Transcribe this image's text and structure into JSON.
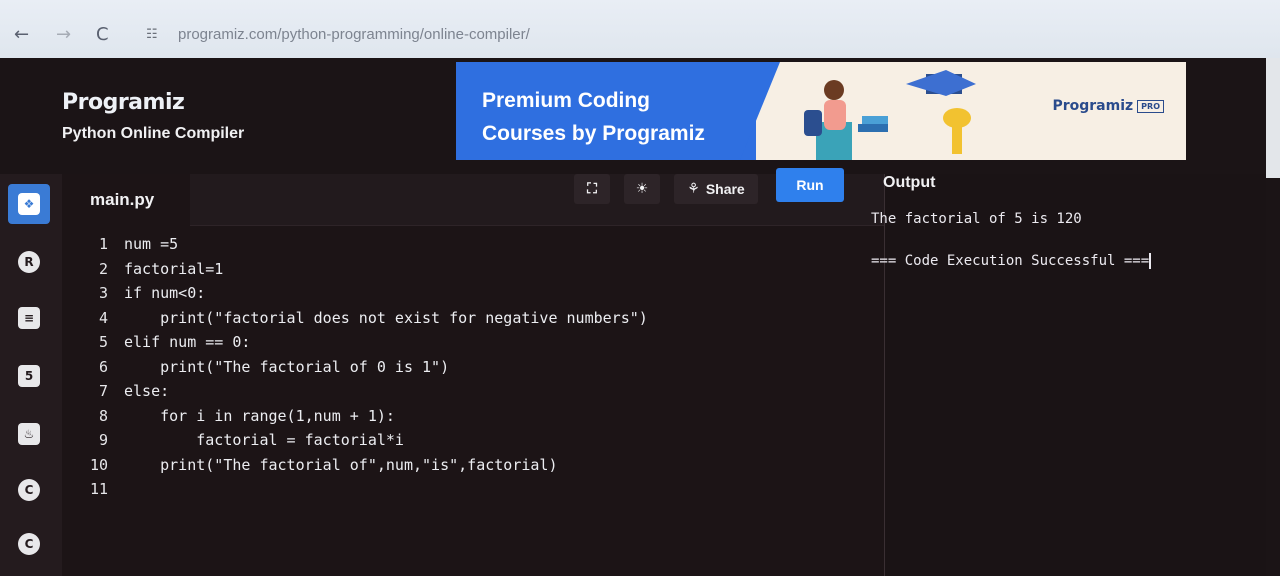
{
  "browser": {
    "back_icon": "←",
    "forward_icon": "→",
    "reload_icon": "C",
    "site_info_icon": "☷",
    "url": "programiz.com/python-programming/online-compiler/"
  },
  "header": {
    "logo": "Programiz",
    "subtitle": "Python Online Compiler"
  },
  "ad": {
    "headline_line1": "Premium Coding",
    "headline_line2": "Courses by Programiz",
    "brand": "Programiz",
    "badge": "PRO"
  },
  "rail": {
    "items": [
      {
        "name": "python",
        "glyph": "❖",
        "active": true
      },
      {
        "name": "r",
        "glyph": "R",
        "active": false
      },
      {
        "name": "sql",
        "glyph": "≡",
        "active": false
      },
      {
        "name": "html",
        "glyph": "5",
        "active": false
      },
      {
        "name": "java",
        "glyph": "♨",
        "active": false
      },
      {
        "name": "c",
        "glyph": "C",
        "active": false
      },
      {
        "name": "cpp",
        "glyph": "C",
        "active": false
      }
    ]
  },
  "editor": {
    "file_name": "main.py",
    "fullscreen_icon": "⛶",
    "theme_icon": "☀",
    "share_icon": "⚘",
    "share_label": "Share",
    "run_label": "Run",
    "lines": [
      "num =5",
      "factorial=1",
      "if num<0:",
      "    print(\"factorial does not exist for negative numbers\")",
      "elif num == 0:",
      "    print(\"The factorial of 0 is 1\")",
      "else:",
      "    for i in range(1,num + 1):",
      "        factorial = factorial*i",
      "    print(\"The factorial of\",num,\"is\",factorial)",
      ""
    ]
  },
  "output": {
    "title": "Output",
    "result_line": "The factorial of 5 is 120",
    "status_line": "=== Code Execution Successful ==="
  },
  "colors": {
    "accent": "#2f80ed",
    "ad_blue": "#2f6fe0",
    "background": "#1b1416"
  }
}
